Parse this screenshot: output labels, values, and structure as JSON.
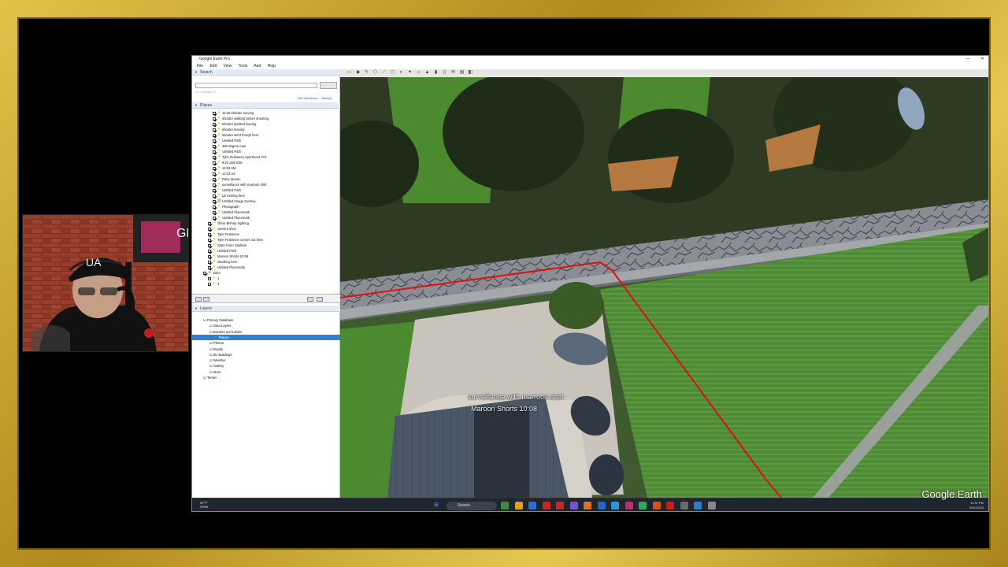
{
  "window": {
    "title": "Google Earth Pro",
    "minimize": "—",
    "close": "✕"
  },
  "menu": [
    "File",
    "Edit",
    "View",
    "Tools",
    "Add",
    "Help"
  ],
  "search": {
    "header": "Search",
    "placeholder": "",
    "button": "",
    "hint": "ex: Chicago, IL",
    "get_directions": "Get Directions",
    "history": "History"
  },
  "places": {
    "header": "Places",
    "items": [
      {
        "label": "12:26 shooter moving",
        "icon": "pin",
        "checked": true,
        "indent": 3
      },
      {
        "label": "shooter walking before shooting",
        "icon": "pin",
        "checked": true,
        "indent": 3
      },
      {
        "label": "shooter spotted leaving",
        "icon": "pin",
        "checked": true,
        "indent": 3
      },
      {
        "label": "shooter leaving",
        "icon": "pin",
        "checked": true,
        "indent": 3
      },
      {
        "label": "shooter went throgh here",
        "icon": "pin",
        "checked": true,
        "indent": 3
      },
      {
        "label": "Untitled Path",
        "icon": "path",
        "checked": true,
        "indent": 3
      },
      {
        "label": "360 degree cam",
        "icon": "pin",
        "checked": true,
        "indent": 3
      },
      {
        "label": "Untitled Path",
        "icon": "path",
        "checked": true,
        "indent": 3
      },
      {
        "label": "Tyler Robinson Apartment #72",
        "icon": "pin",
        "checked": true,
        "indent": 3
      },
      {
        "label": "8:23 and 9:58",
        "icon": "pin",
        "checked": true,
        "indent": 3
      },
      {
        "label": "11:53 AM",
        "icon": "pin",
        "checked": true,
        "indent": 3
      },
      {
        "label": "12:23:34",
        "icon": "pin",
        "checked": true,
        "indent": 3
      },
      {
        "label": "Dairy Queen",
        "icon": "pin",
        "checked": true,
        "indent": 3
      },
      {
        "label": "surveillance with marroon shirt",
        "icon": "pin",
        "checked": true,
        "indent": 3
      },
      {
        "label": "Untitled Path",
        "icon": "path",
        "checked": true,
        "indent": 3
      },
      {
        "label": "LE looking here",
        "icon": "pin",
        "checked": true,
        "indent": 3
      },
      {
        "label": "Untitled Image Overlay",
        "icon": "img",
        "checked": true,
        "indent": 3
      },
      {
        "label": "Photograph",
        "icon": "pin",
        "checked": true,
        "indent": 3
      },
      {
        "label": "Untitled Placemark",
        "icon": "pin",
        "checked": true,
        "indent": 3
      },
      {
        "label": "Untitled Placemark",
        "icon": "pin",
        "checked": true,
        "indent": 3
      },
      {
        "label": "Olivia Bishop sighting",
        "icon": "pin",
        "checked": true,
        "indent": 2
      },
      {
        "label": "camera shot",
        "icon": "pin",
        "checked": true,
        "indent": 2
      },
      {
        "label": "Tyler Robinson",
        "icon": "pin",
        "checked": true,
        "indent": 2
      },
      {
        "label": "Tyler Robinson comes out here",
        "icon": "pin",
        "checked": true,
        "indent": 2
      },
      {
        "label": "State Farm Stadium",
        "icon": "pin",
        "checked": true,
        "indent": 2
      },
      {
        "label": "Untitled Path",
        "icon": "path",
        "checked": true,
        "indent": 2
      },
      {
        "label": "Maroon Shorts 10:08",
        "icon": "pin",
        "checked": true,
        "indent": 2
      },
      {
        "label": "standing here",
        "icon": "pin",
        "checked": true,
        "indent": 2
      },
      {
        "label": "Untitled Placemark",
        "icon": "pin",
        "checked": true,
        "indent": 2
      },
      {
        "label": "video",
        "icon": "folder",
        "checked": true,
        "indent": 1
      },
      {
        "label": "1",
        "icon": "pin",
        "checked": false,
        "indent": 2
      },
      {
        "label": "3",
        "icon": "pin",
        "checked": false,
        "indent": 2
      }
    ]
  },
  "layers": {
    "header": "Layers",
    "items": [
      {
        "label": "Primary Database",
        "indent": 1,
        "selected": false
      },
      {
        "label": "Data Layers",
        "indent": 2,
        "selected": false
      },
      {
        "label": "Borders and Labels",
        "indent": 2,
        "selected": false
      },
      {
        "label": "Places",
        "indent": 2,
        "selected": true
      },
      {
        "label": "Photos",
        "indent": 2,
        "selected": false
      },
      {
        "label": "Roads",
        "indent": 2,
        "selected": false
      },
      {
        "label": "3D Buildings",
        "indent": 2,
        "selected": false
      },
      {
        "label": "Weather",
        "indent": 2,
        "selected": false
      },
      {
        "label": "Gallery",
        "indent": 2,
        "selected": false
      },
      {
        "label": "More",
        "indent": 2,
        "selected": false
      },
      {
        "label": "Terrain",
        "indent": 1,
        "selected": false
      }
    ]
  },
  "map": {
    "label1": "surveillance with marroon shirt",
    "label2": "Maroon Shorts 10:08",
    "logo": "Google Earth",
    "path_color": "#e01010"
  },
  "taskbar": {
    "weather_temp": "57°F",
    "weather_desc": "Clear",
    "search": "Search",
    "tray_time": "10:11 PM",
    "tray_date": "9/21/2025"
  },
  "webcam": {
    "cap_logo": "UA",
    "sign_text": "GF"
  }
}
